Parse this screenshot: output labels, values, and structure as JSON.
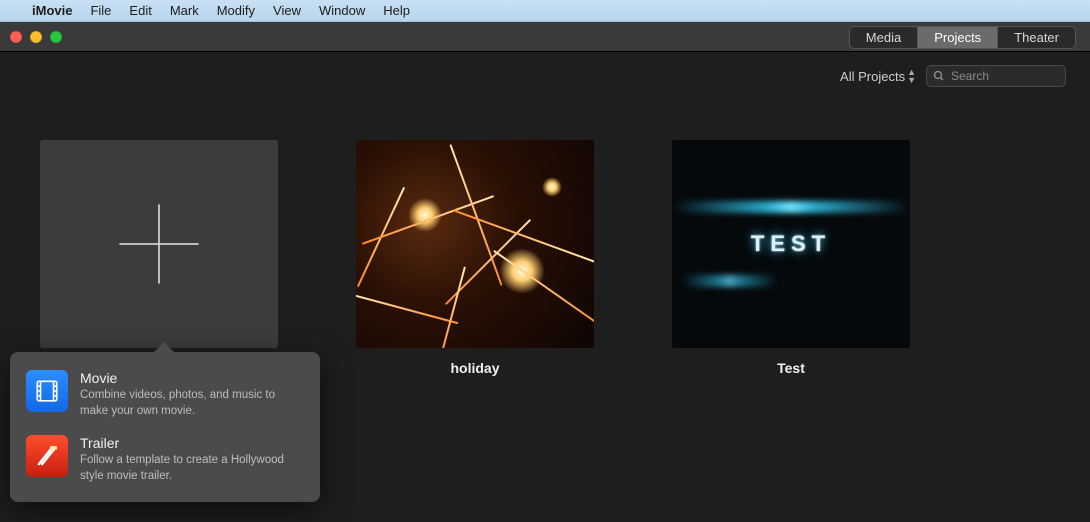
{
  "menubar": {
    "app": "iMovie",
    "items": [
      "File",
      "Edit",
      "Mark",
      "Modify",
      "View",
      "Window",
      "Help"
    ]
  },
  "tabs": {
    "media": "Media",
    "projects": "Projects",
    "theater": "Theater",
    "selected": "projects"
  },
  "toolbar": {
    "filter_label": "All Projects",
    "search_placeholder": "Search",
    "search_value": ""
  },
  "projects": [
    {
      "id": "new",
      "title": "",
      "kind": "new"
    },
    {
      "id": "holiday",
      "title": "holiday",
      "kind": "fireworks"
    },
    {
      "id": "test",
      "title": "Test",
      "kind": "test",
      "overlay_text": "TEST"
    }
  ],
  "popover": {
    "movie": {
      "title": "Movie",
      "desc": "Combine videos, photos, and music to make your own movie."
    },
    "trailer": {
      "title": "Trailer",
      "desc": "Follow a template to create a Hollywood style movie trailer."
    }
  }
}
